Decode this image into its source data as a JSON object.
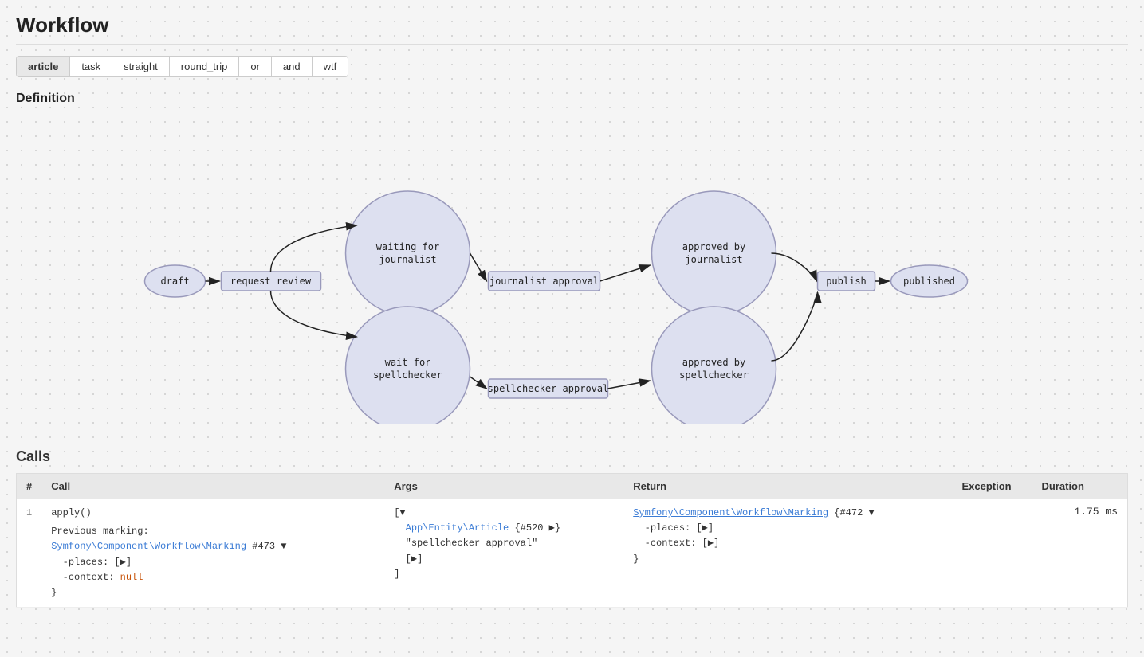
{
  "page": {
    "title": "Workflow"
  },
  "tabs": [
    {
      "id": "article",
      "label": "article",
      "active": true
    },
    {
      "id": "task",
      "label": "task",
      "active": false
    },
    {
      "id": "straight",
      "label": "straight",
      "active": false
    },
    {
      "id": "round_trip",
      "label": "round_trip",
      "active": false
    },
    {
      "id": "or",
      "label": "or",
      "active": false
    },
    {
      "id": "and",
      "label": "and",
      "active": false
    },
    {
      "id": "wtf",
      "label": "wtf",
      "active": false
    }
  ],
  "sections": {
    "definition": "Definition",
    "calls": "Calls"
  },
  "calls_table": {
    "headers": [
      "#",
      "Call",
      "Args",
      "Return",
      "Exception",
      "Duration"
    ],
    "rows": [
      {
        "num": "1",
        "call": "apply()",
        "call_detail_label": "Previous marking:",
        "call_detail_class": "Symfony\\Component\\Workflow\\Marking",
        "call_detail_id": "#473",
        "call_detail_expand": "▼",
        "call_detail_places": "-places: [▶]",
        "call_detail_context": "-context: null",
        "call_detail_close": "}",
        "args_open": "[▼",
        "args_entity": "App\\Entity\\Article",
        "args_entity_id": "{#520 ▶}",
        "args_string": "\"spellchecker approval\"",
        "args_arr": "[▶]",
        "args_close": "]",
        "return_class": "Symfony\\Component\\Workflow\\Marking",
        "return_id": "{#472",
        "return_expand": "▼",
        "return_places": "-places: [▶]",
        "return_context": "-context: [▶]",
        "return_close": "}",
        "exception": "",
        "duration": "1.75 ms"
      }
    ]
  },
  "colors": {
    "node_fill": "#dde0f0",
    "node_stroke": "#9999bb",
    "transition_fill": "#f0f0f8",
    "transition_stroke": "#9999bb",
    "arrow": "#222"
  }
}
